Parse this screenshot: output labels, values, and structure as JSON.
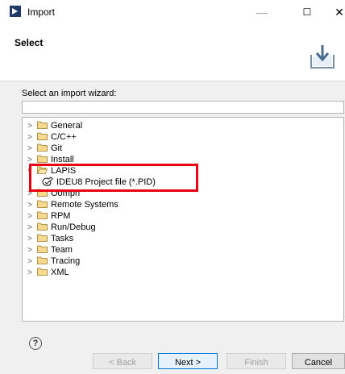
{
  "window": {
    "title": "Import",
    "minimize_glyph": "—",
    "maximize_glyph": "☐",
    "close_glyph": "✕"
  },
  "header": {
    "title": "Select",
    "banner_icon": "import-banner-icon"
  },
  "wizard": {
    "label": "Select an import wizard:",
    "filter_value": "",
    "filter_placeholder": ""
  },
  "tree": {
    "items": [
      {
        "label": "General",
        "expanded": false
      },
      {
        "label": "C/C++",
        "expanded": false
      },
      {
        "label": "Git",
        "expanded": false
      },
      {
        "label": "Install",
        "expanded": false
      },
      {
        "label": "LAPIS",
        "expanded": true
      },
      {
        "label": "IDEU8 Project file (*.PID)",
        "child": true
      },
      {
        "label": "Oomph",
        "expanded": false
      },
      {
        "label": "Remote Systems",
        "expanded": false
      },
      {
        "label": "RPM",
        "expanded": false
      },
      {
        "label": "Run/Debug",
        "expanded": false
      },
      {
        "label": "Tasks",
        "expanded": false
      },
      {
        "label": "Team",
        "expanded": false
      },
      {
        "label": "Tracing",
        "expanded": false
      },
      {
        "label": "XML",
        "expanded": false
      }
    ]
  },
  "footer": {
    "help_glyph": "?",
    "back_label": "< Back",
    "next_label": "Next >",
    "finish_label": "Finish",
    "cancel_label": "Cancel"
  },
  "colors": {
    "highlight": "#e60012",
    "folder": "#e8c26a",
    "accent": "#0078d7"
  }
}
